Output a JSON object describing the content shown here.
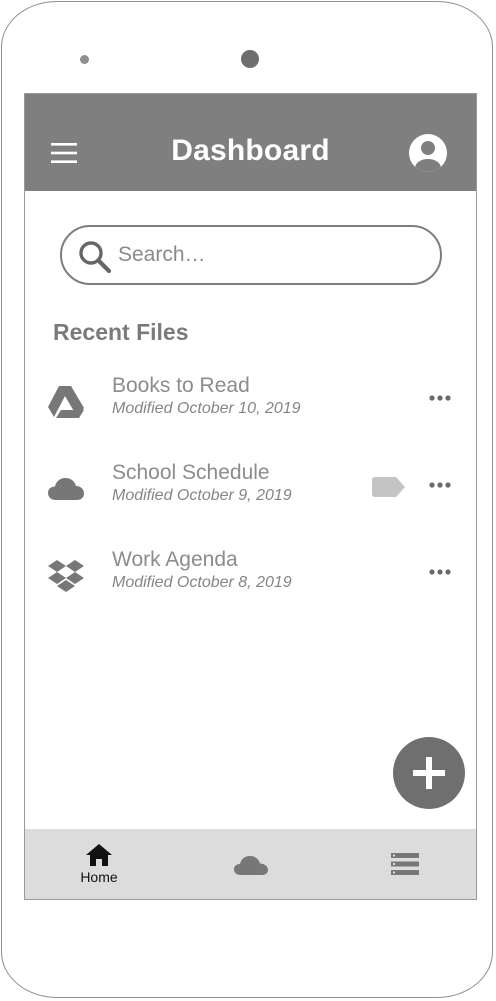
{
  "header": {
    "title": "Dashboard",
    "menu_icon": "hamburger-menu-icon",
    "account_icon": "account-circle-icon"
  },
  "search": {
    "placeholder": "Search…",
    "value": "",
    "icon": "search-icon"
  },
  "recent_files": {
    "title": "Recent Files",
    "items": [
      {
        "name": "Books to Read",
        "modified": "Modified October 10, 2019",
        "icon": "google-drive-icon",
        "tagged": false
      },
      {
        "name": "School Schedule",
        "modified": "Modified October 9, 2019",
        "icon": "cloud-icon",
        "tagged": true
      },
      {
        "name": "Work Agenda",
        "modified": "Modified October 8, 2019",
        "icon": "dropbox-icon",
        "tagged": false
      }
    ]
  },
  "fab": {
    "icon": "plus-icon"
  },
  "bottom_nav": {
    "home_label": "Home",
    "home_icon": "home-icon",
    "cloud_icon": "cloud-icon",
    "list_icon": "list-icon"
  },
  "colors": {
    "header_bg": "#7f7f7f",
    "fab_bg": "#6f6f6f",
    "bottom_nav_bg": "#dcdcdc",
    "text_gray": "#8c8c8c"
  }
}
